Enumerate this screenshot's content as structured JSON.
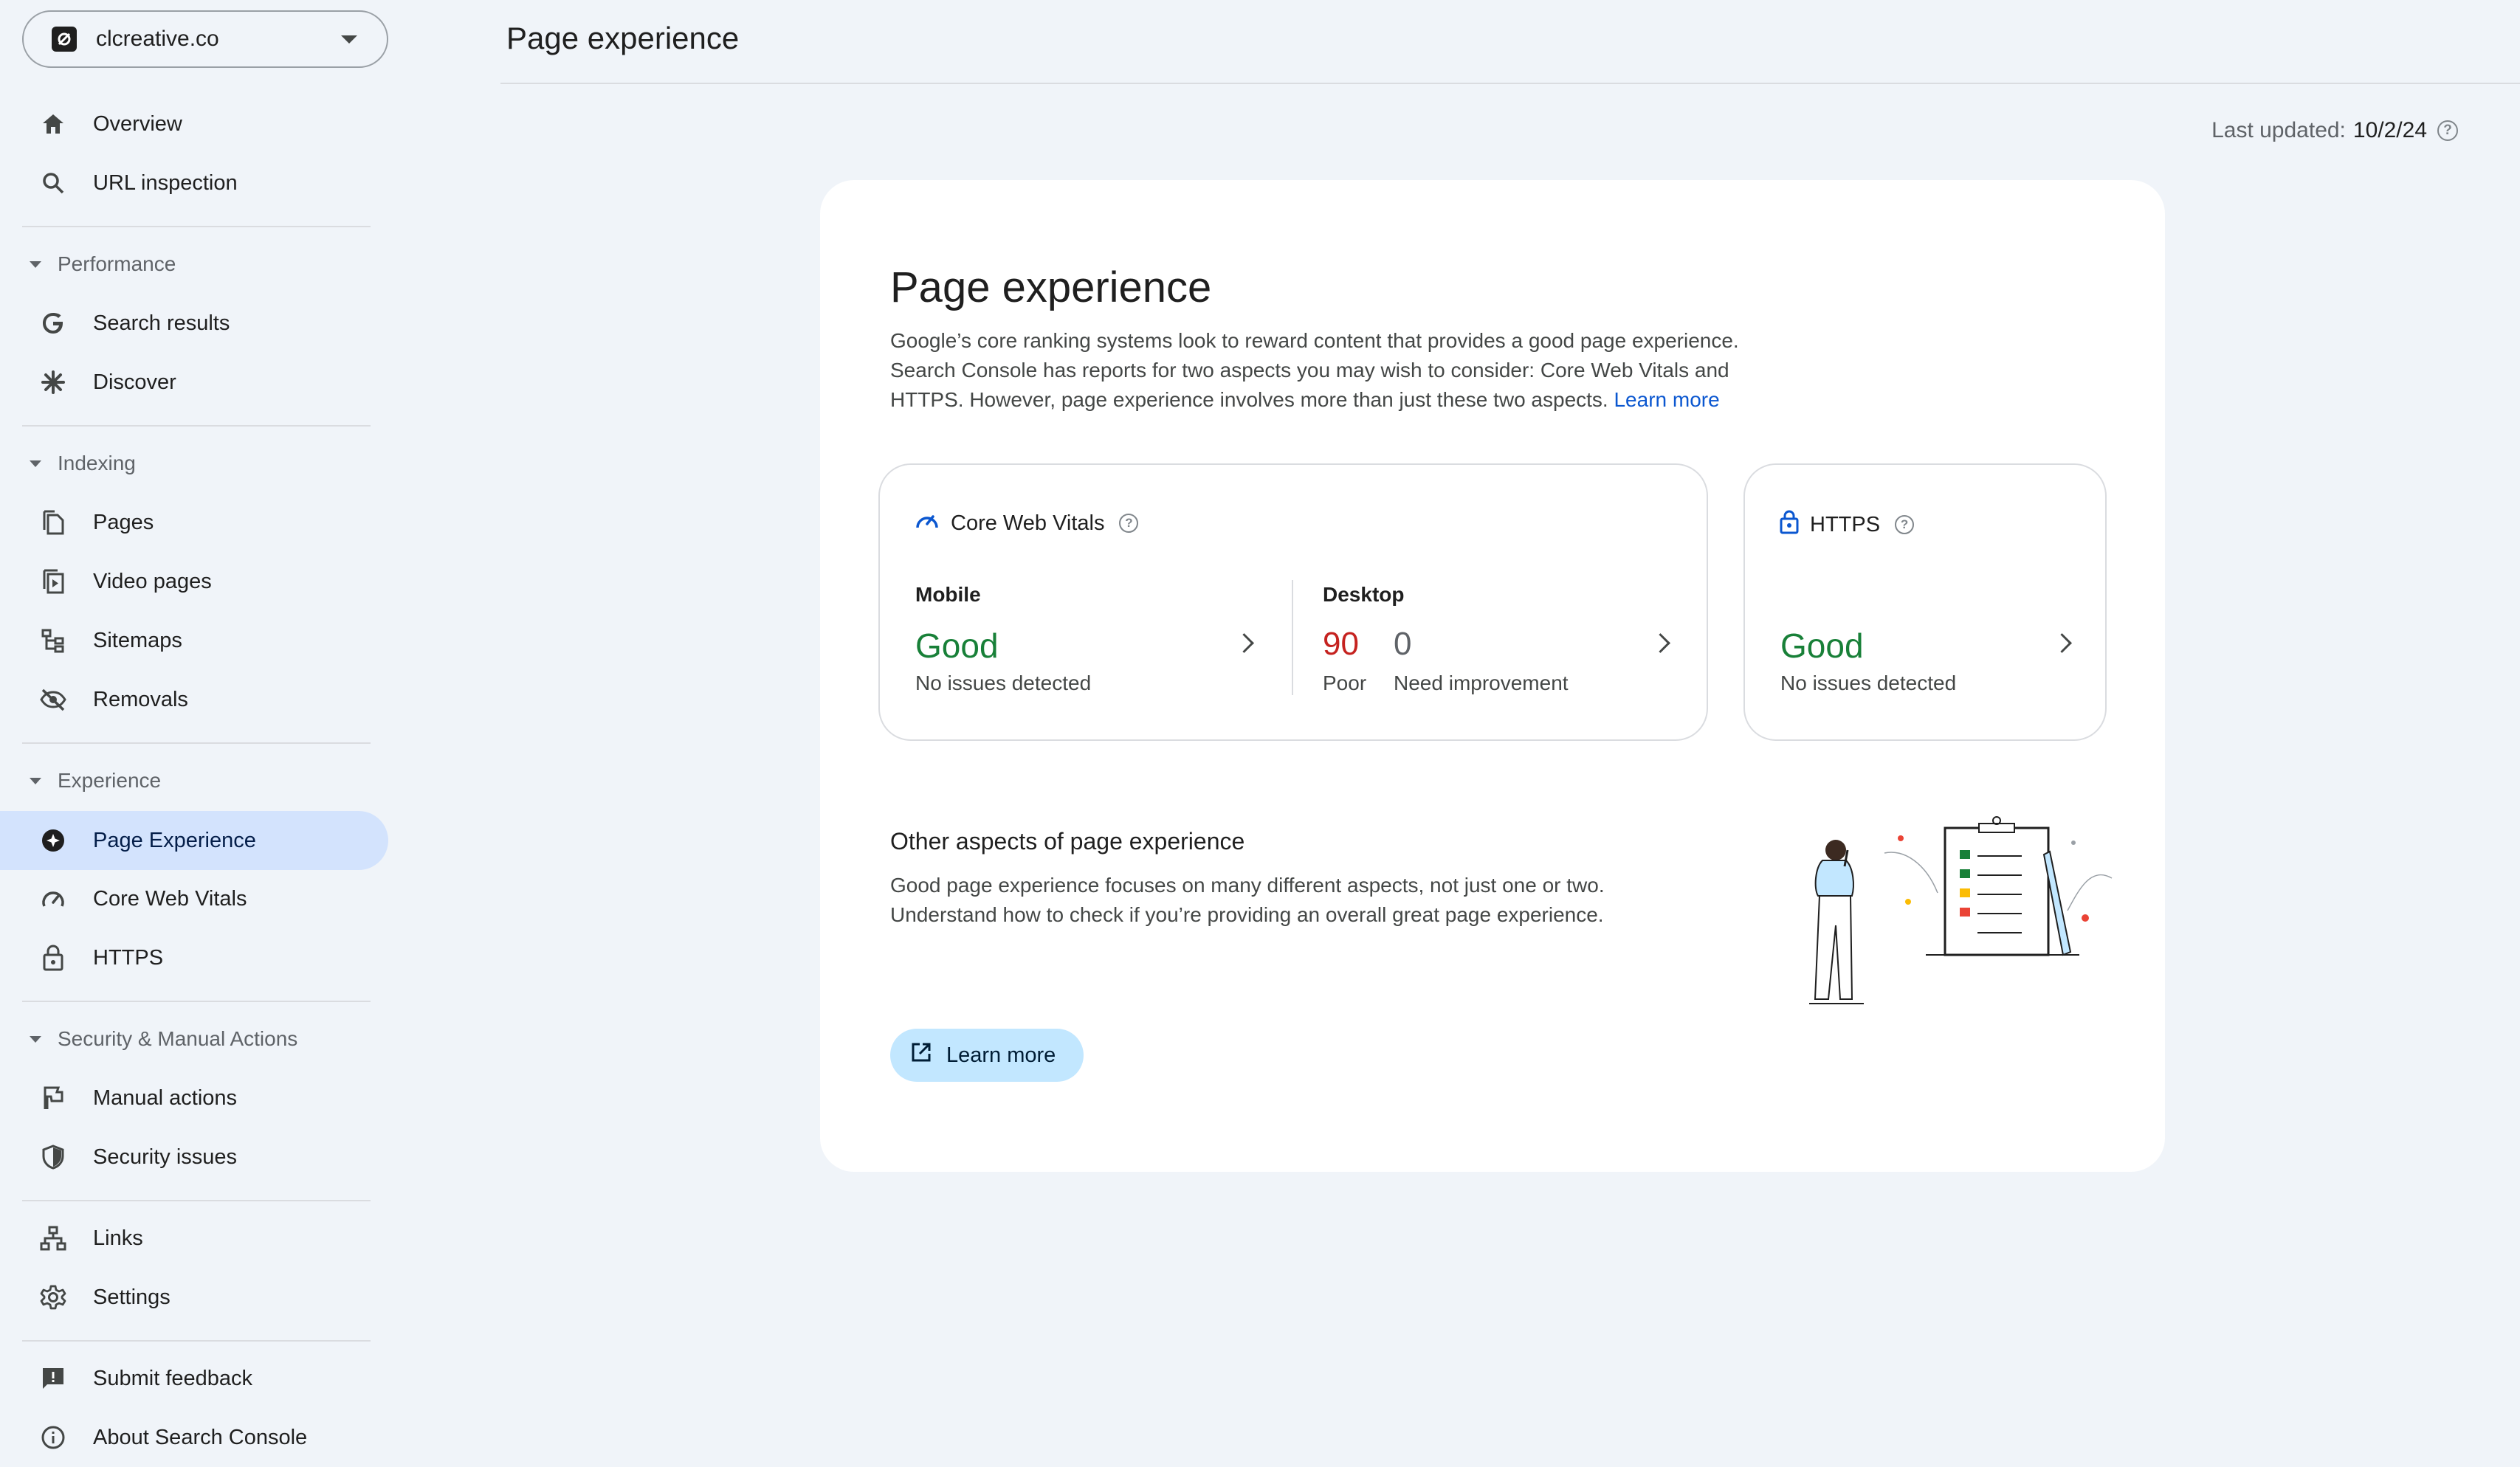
{
  "property": {
    "name": "clcreative.co"
  },
  "sidebar": {
    "top_items": [
      {
        "label": "Overview",
        "icon": "home-icon"
      },
      {
        "label": "URL inspection",
        "icon": "search-icon"
      }
    ],
    "sections": {
      "performance": {
        "title": "Performance",
        "items": [
          {
            "label": "Search results",
            "icon": "google-g-icon"
          },
          {
            "label": "Discover",
            "icon": "asterisk-icon"
          }
        ]
      },
      "indexing": {
        "title": "Indexing",
        "items": [
          {
            "label": "Pages",
            "icon": "pages-icon"
          },
          {
            "label": "Video pages",
            "icon": "video-pages-icon"
          },
          {
            "label": "Sitemaps",
            "icon": "sitemap-icon"
          },
          {
            "label": "Removals",
            "icon": "eye-off-icon"
          }
        ]
      },
      "experience": {
        "title": "Experience",
        "items": [
          {
            "label": "Page Experience",
            "icon": "page-experience-icon",
            "active": true
          },
          {
            "label": "Core Web Vitals",
            "icon": "gauge-icon"
          },
          {
            "label": "HTTPS",
            "icon": "lock-icon"
          }
        ]
      },
      "security": {
        "title": "Security & Manual Actions",
        "items": [
          {
            "label": "Manual actions",
            "icon": "flag-icon"
          },
          {
            "label": "Security issues",
            "icon": "shield-icon"
          }
        ]
      }
    },
    "bottom_items": [
      {
        "label": "Links",
        "icon": "links-icon"
      },
      {
        "label": "Settings",
        "icon": "gear-icon"
      },
      {
        "label": "Submit feedback",
        "icon": "feedback-icon"
      },
      {
        "label": "About Search Console",
        "icon": "info-icon"
      }
    ]
  },
  "header": {
    "title": "Page experience",
    "last_updated_label": "Last updated:",
    "last_updated_value": "10/2/24"
  },
  "main": {
    "title": "Page experience",
    "description": "Google’s core ranking systems look to reward content that provides a good page experience. Search Console has reports for two aspects you may wish to consider: Core Web Vitals and HTTPS. However, page experience involves more than just these two aspects.",
    "description_link": "Learn more",
    "core_web_vitals": {
      "title": "Core Web Vitals",
      "mobile": {
        "label": "Mobile",
        "status": "Good",
        "detail": "No issues detected"
      },
      "desktop": {
        "label": "Desktop",
        "poor_count": "90",
        "poor_label": "Poor",
        "ni_count": "0",
        "ni_label": "Need improvement"
      }
    },
    "https": {
      "title": "HTTPS",
      "status": "Good",
      "detail": "No issues detected"
    },
    "other": {
      "title": "Other aspects of page experience",
      "description": "Good page experience focuses on many different aspects, not just one or two. Understand how to check if you’re providing an overall great page experience.",
      "button_label": "Learn more"
    }
  },
  "colors": {
    "good": "#188038",
    "poor": "#c5221f",
    "accent": "#0b57d0",
    "active_nav": "#d3e3fd"
  }
}
